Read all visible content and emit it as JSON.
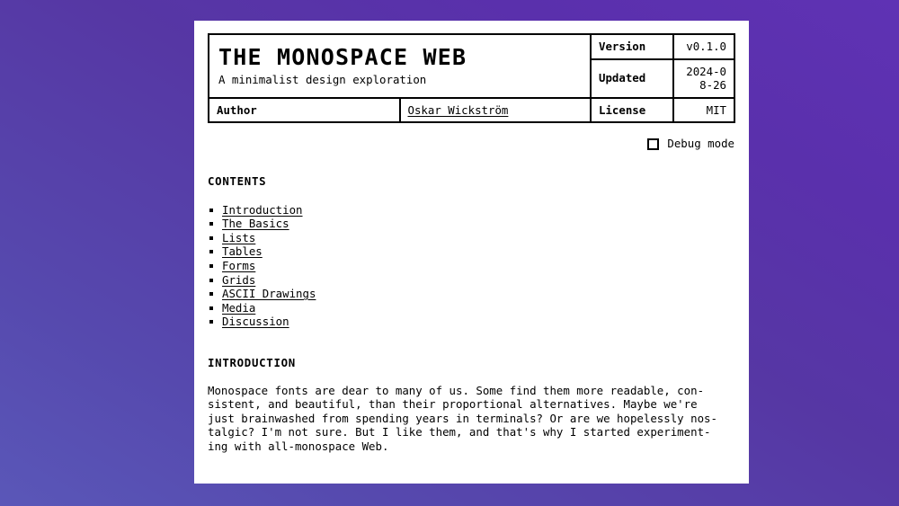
{
  "document": {
    "title": "THE MONOSPACE WEB",
    "subtitle": "A minimalist design exploration"
  },
  "meta_table": {
    "version_label": "Version",
    "version_value": "v0.1.0",
    "updated_label": "Updated",
    "updated_value": "2024-08-26",
    "license_label": "License",
    "license_value": "MIT",
    "author_label": "Author",
    "author_value": "Oskar Wickström"
  },
  "debug": {
    "label": "Debug mode",
    "checked": false,
    "icon": "checkbox-unchecked-icon"
  },
  "contents": {
    "heading": "Contents",
    "items": [
      {
        "label": "Introduction"
      },
      {
        "label": "The Basics"
      },
      {
        "label": "Lists"
      },
      {
        "label": "Tables"
      },
      {
        "label": "Forms"
      },
      {
        "label": "Grids"
      },
      {
        "label": "ASCII Drawings"
      },
      {
        "label": "Media"
      },
      {
        "label": "Discussion"
      }
    ]
  },
  "introduction": {
    "heading": "Introduction",
    "paragraph": "Monospace fonts are dear to many of us. Some find them more readable, con-\nsistent, and beautiful, than their proportional alternatives. Maybe we're\njust brainwashed from spending years in terminals? Or are we hopelessly nos-\ntalgic? I'm not sure. But I like them, and that's why I started experiment-\ning with all-monospace Web."
  },
  "colors": {
    "page_background": "#ffffff",
    "text": "#000000",
    "border": "#000000",
    "desktop_gradient_start": "#5a57b8",
    "desktop_gradient_end": "#5f32b4"
  }
}
